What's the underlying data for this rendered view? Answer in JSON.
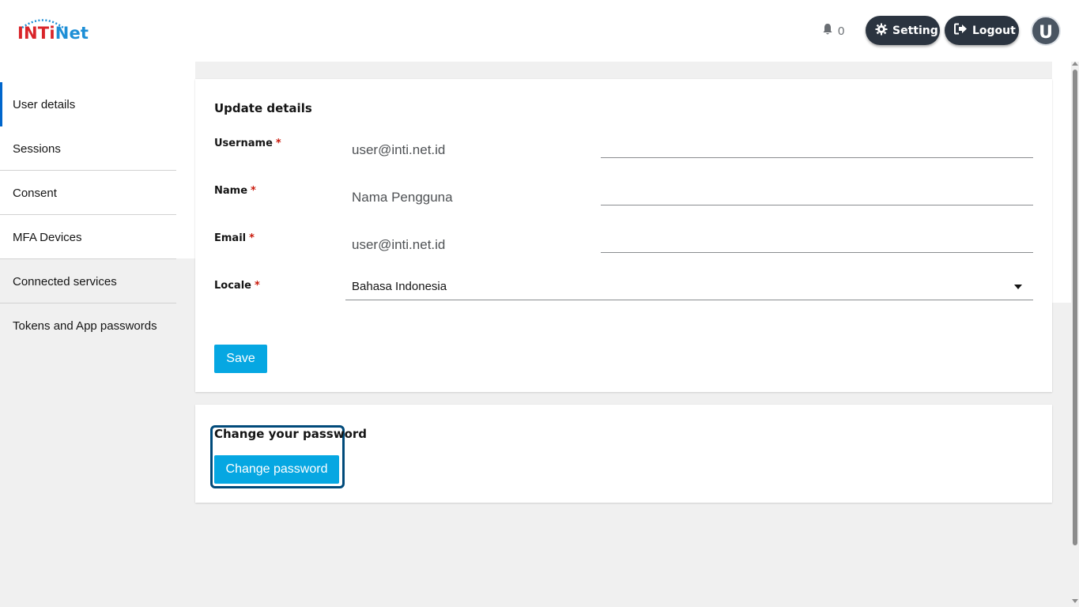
{
  "header": {
    "logo_part1": "INTi",
    "logo_part2": "Net",
    "notification_count": "0",
    "setting_label": "Setting",
    "logout_label": "Logout",
    "avatar_initial": "U"
  },
  "sidebar": {
    "items": [
      {
        "label": "User details",
        "active": true
      },
      {
        "label": "Sessions"
      },
      {
        "label": "Consent"
      },
      {
        "label": "MFA Devices"
      },
      {
        "label": "Connected services"
      },
      {
        "label": "Tokens and App passwords"
      }
    ]
  },
  "details_form": {
    "title": "Update details",
    "required_mark": "*",
    "username_label": "Username",
    "username_value": "user@inti.net.id",
    "name_label": "Name",
    "name_value": "Nama Pengguna",
    "email_label": "Email",
    "email_value": "user@inti.net.id",
    "locale_label": "Locale",
    "locale_value": "Bahasa Indonesia",
    "save_label": "Save"
  },
  "password_section": {
    "title": "Change your password",
    "button_label": "Change password"
  },
  "colors": {
    "primary_button": "#06a7e2",
    "header_button": "#2b3440",
    "required": "#c9190b",
    "active_indicator": "#0066cc",
    "focus_ring": "#004a7a"
  }
}
